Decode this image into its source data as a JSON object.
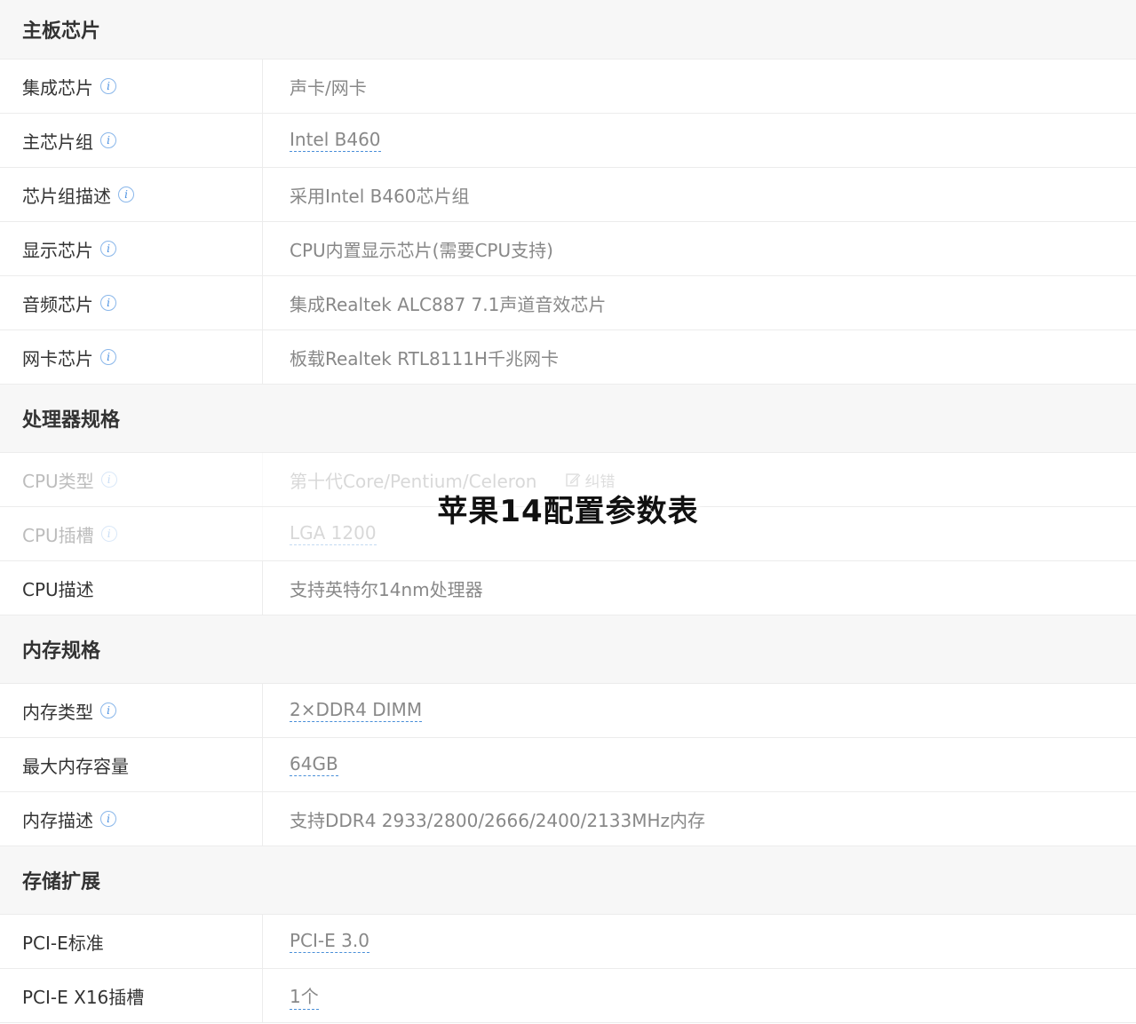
{
  "sections": [
    {
      "title": "主板芯片",
      "rows": [
        {
          "label": "集成芯片",
          "value": "声卡/网卡"
        },
        {
          "label": "主芯片组",
          "value": "Intel B460"
        },
        {
          "label": "芯片组描述",
          "value": "采用Intel B460芯片组"
        },
        {
          "label": "显示芯片",
          "value": "CPU内置显示芯片(需要CPU支持)"
        },
        {
          "label": "音频芯片",
          "value": "集成Realtek ALC887 7.1声道音效芯片"
        },
        {
          "label": "网卡芯片",
          "value": "板载Realtek RTL8111H千兆网卡"
        }
      ]
    },
    {
      "title": "处理器规格",
      "rows": [
        {
          "label": "CPU类型",
          "value": "第十代Core/Pentium/Celeron",
          "edit": "纠错"
        },
        {
          "label": "CPU插槽",
          "value": "LGA 1200"
        },
        {
          "label": "CPU描述",
          "value": "支持英特尔14nm处理器"
        }
      ]
    },
    {
      "title": "内存规格",
      "rows": [
        {
          "label": "内存类型",
          "value": "2×DDR4 DIMM"
        },
        {
          "label": "最大内存容量",
          "value": "64GB"
        },
        {
          "label": "内存描述",
          "value": "支持DDR4 2933/2800/2666/2400/2133MHz内存"
        }
      ]
    },
    {
      "title": "存储扩展",
      "rows": [
        {
          "label": "PCI-E标准",
          "value": "PCI-E 3.0"
        },
        {
          "label": "PCI-E X16插槽",
          "value": "1个"
        }
      ]
    }
  ],
  "overlay_title": "苹果14配置参数表",
  "info_icon": "i",
  "colors": {
    "accent": "#4a90e2",
    "label": "#333333",
    "value": "#888888",
    "section_bg": "#f7f7f7"
  }
}
